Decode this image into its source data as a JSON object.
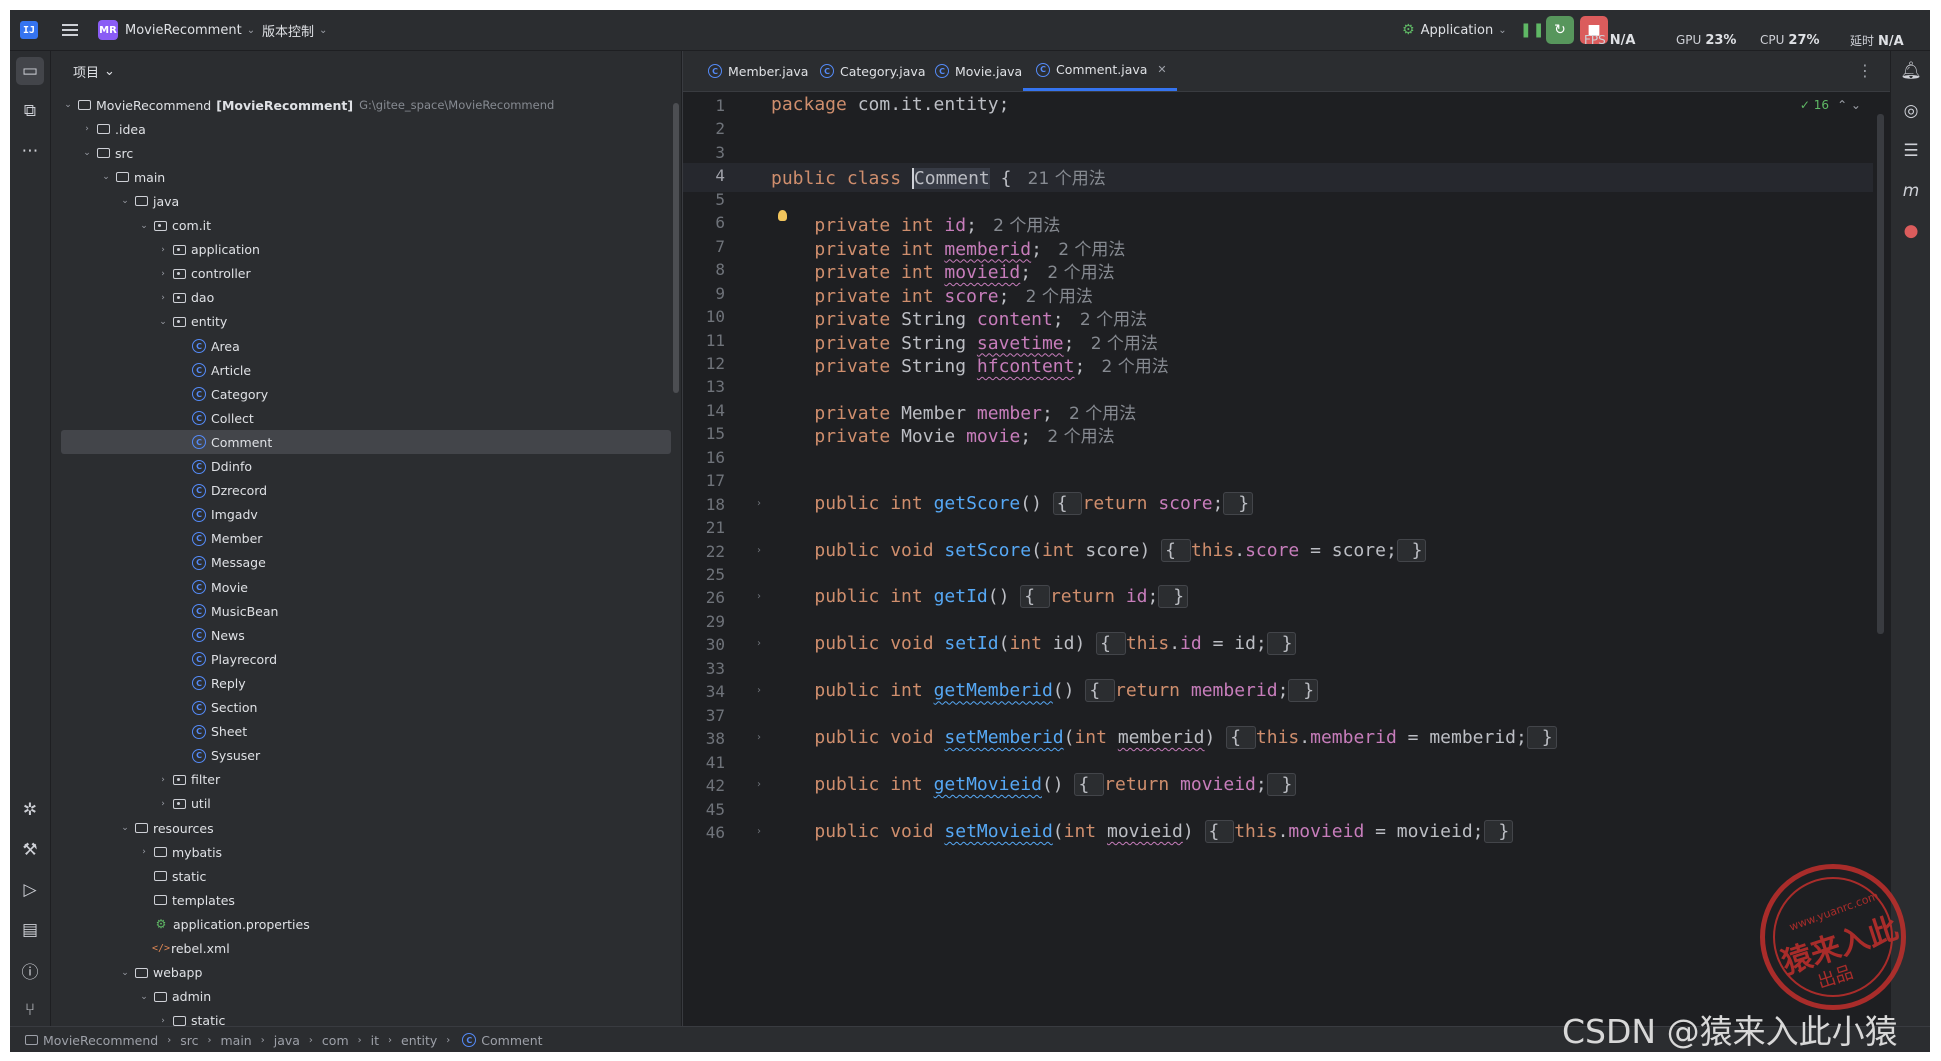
{
  "titlebar": {
    "app_logo": "IJ",
    "project_badge": "MR",
    "project_name": "MovieRecomment",
    "vcs_label": "版本控制",
    "run_config": "Application",
    "fps_label": "FPS",
    "fps_value": "N/A",
    "gpu_label": "GPU",
    "gpu_value": "23%",
    "cpu_label": "CPU",
    "cpu_value": "27%",
    "delay_label": "延时",
    "delay_value": "N/A"
  },
  "project_panel": {
    "title": "项目",
    "root_name": "MovieRecommend",
    "root_module": "[MovieRecomment]",
    "root_path": "G:\\gitee_space\\MovieRecommend",
    "tree": [
      {
        "label": ".idea",
        "depth": 1,
        "kind": "folder",
        "expanded": false
      },
      {
        "label": "src",
        "depth": 1,
        "kind": "folder",
        "expanded": true
      },
      {
        "label": "main",
        "depth": 2,
        "kind": "folder",
        "expanded": true
      },
      {
        "label": "java",
        "depth": 3,
        "kind": "folder",
        "expanded": true
      },
      {
        "label": "com.it",
        "depth": 4,
        "kind": "package",
        "expanded": true
      },
      {
        "label": "application",
        "depth": 5,
        "kind": "package",
        "expanded": false
      },
      {
        "label": "controller",
        "depth": 5,
        "kind": "package",
        "expanded": false
      },
      {
        "label": "dao",
        "depth": 5,
        "kind": "package",
        "expanded": false
      },
      {
        "label": "entity",
        "depth": 5,
        "kind": "package",
        "expanded": true
      },
      {
        "label": "Area",
        "depth": 6,
        "kind": "class"
      },
      {
        "label": "Article",
        "depth": 6,
        "kind": "class"
      },
      {
        "label": "Category",
        "depth": 6,
        "kind": "class"
      },
      {
        "label": "Collect",
        "depth": 6,
        "kind": "class"
      },
      {
        "label": "Comment",
        "depth": 6,
        "kind": "class",
        "selected": true
      },
      {
        "label": "Ddinfo",
        "depth": 6,
        "kind": "class"
      },
      {
        "label": "Dzrecord",
        "depth": 6,
        "kind": "class"
      },
      {
        "label": "Imgadv",
        "depth": 6,
        "kind": "class"
      },
      {
        "label": "Member",
        "depth": 6,
        "kind": "class"
      },
      {
        "label": "Message",
        "depth": 6,
        "kind": "class"
      },
      {
        "label": "Movie",
        "depth": 6,
        "kind": "class"
      },
      {
        "label": "MusicBean",
        "depth": 6,
        "kind": "class"
      },
      {
        "label": "News",
        "depth": 6,
        "kind": "class"
      },
      {
        "label": "Playrecord",
        "depth": 6,
        "kind": "class"
      },
      {
        "label": "Reply",
        "depth": 6,
        "kind": "class"
      },
      {
        "label": "Section",
        "depth": 6,
        "kind": "class"
      },
      {
        "label": "Sheet",
        "depth": 6,
        "kind": "class"
      },
      {
        "label": "Sysuser",
        "depth": 6,
        "kind": "class"
      },
      {
        "label": "filter",
        "depth": 5,
        "kind": "package",
        "expanded": false
      },
      {
        "label": "util",
        "depth": 5,
        "kind": "package",
        "expanded": false
      },
      {
        "label": "resources",
        "depth": 3,
        "kind": "folder",
        "expanded": true
      },
      {
        "label": "mybatis",
        "depth": 4,
        "kind": "folder",
        "expanded": false
      },
      {
        "label": "static",
        "depth": 4,
        "kind": "folder"
      },
      {
        "label": "templates",
        "depth": 4,
        "kind": "folder"
      },
      {
        "label": "application.properties",
        "depth": 4,
        "kind": "config"
      },
      {
        "label": "rebel.xml",
        "depth": 4,
        "kind": "xml"
      },
      {
        "label": "webapp",
        "depth": 3,
        "kind": "folder",
        "expanded": true
      },
      {
        "label": "admin",
        "depth": 4,
        "kind": "folder",
        "expanded": true
      },
      {
        "label": "static",
        "depth": 5,
        "kind": "folder",
        "expanded": false
      }
    ]
  },
  "editor": {
    "tabs": [
      {
        "label": "Member.java",
        "active": false
      },
      {
        "label": "Category.java",
        "active": false
      },
      {
        "label": "Movie.java",
        "active": false
      },
      {
        "label": "Comment.java",
        "active": true
      }
    ],
    "inspection_count": "16",
    "current_line": "4",
    "lines": [
      {
        "n": "1",
        "tokens": [
          [
            "kw",
            "package"
          ],
          [
            "p",
            " com.it.entity;"
          ]
        ]
      },
      {
        "n": "2",
        "tokens": []
      },
      {
        "n": "3",
        "tokens": []
      },
      {
        "n": "4",
        "tokens": [
          [
            "kw",
            "public class "
          ],
          [
            "cls",
            "Comment"
          ],
          [
            "p",
            " { "
          ],
          [
            "hint",
            " 21 个用法"
          ]
        ]
      },
      {
        "n": "5",
        "tokens": []
      },
      {
        "n": "6",
        "tokens": [
          [
            "p",
            "    "
          ],
          [
            "kw",
            "private int "
          ],
          [
            "fld",
            "id"
          ],
          [
            "p",
            "; "
          ],
          [
            "hint",
            " 2 个用法"
          ]
        ]
      },
      {
        "n": "7",
        "tokens": [
          [
            "p",
            "    "
          ],
          [
            "kw",
            "private int "
          ],
          [
            "fldu",
            "memberid"
          ],
          [
            "p",
            "; "
          ],
          [
            "hint",
            " 2 个用法"
          ]
        ]
      },
      {
        "n": "8",
        "tokens": [
          [
            "p",
            "    "
          ],
          [
            "kw",
            "private int "
          ],
          [
            "fldu",
            "movieid"
          ],
          [
            "p",
            "; "
          ],
          [
            "hint",
            " 2 个用法"
          ]
        ]
      },
      {
        "n": "9",
        "tokens": [
          [
            "p",
            "    "
          ],
          [
            "kw",
            "private int "
          ],
          [
            "fld",
            "score"
          ],
          [
            "p",
            "; "
          ],
          [
            "hint",
            " 2 个用法"
          ]
        ]
      },
      {
        "n": "10",
        "tokens": [
          [
            "p",
            "    "
          ],
          [
            "kw",
            "private "
          ],
          [
            "p",
            "String "
          ],
          [
            "fld",
            "content"
          ],
          [
            "p",
            "; "
          ],
          [
            "hint",
            " 2 个用法"
          ]
        ]
      },
      {
        "n": "11",
        "tokens": [
          [
            "p",
            "    "
          ],
          [
            "kw",
            "private "
          ],
          [
            "p",
            "String "
          ],
          [
            "fldu",
            "savetime"
          ],
          [
            "p",
            "; "
          ],
          [
            "hint",
            " 2 个用法"
          ]
        ]
      },
      {
        "n": "12",
        "tokens": [
          [
            "p",
            "    "
          ],
          [
            "kw",
            "private "
          ],
          [
            "p",
            "String "
          ],
          [
            "fldu",
            "hfcontent"
          ],
          [
            "p",
            "; "
          ],
          [
            "hint",
            " 2 个用法"
          ]
        ]
      },
      {
        "n": "13",
        "tokens": []
      },
      {
        "n": "14",
        "tokens": [
          [
            "p",
            "    "
          ],
          [
            "kw",
            "private "
          ],
          [
            "p",
            "Member "
          ],
          [
            "fld",
            "member"
          ],
          [
            "p",
            "; "
          ],
          [
            "hint",
            " 2 个用法"
          ]
        ]
      },
      {
        "n": "15",
        "tokens": [
          [
            "p",
            "    "
          ],
          [
            "kw",
            "private "
          ],
          [
            "p",
            "Movie "
          ],
          [
            "fld",
            "movie"
          ],
          [
            "p",
            "; "
          ],
          [
            "hint",
            " 2 个用法"
          ]
        ]
      },
      {
        "n": "16",
        "tokens": []
      },
      {
        "n": "17",
        "tokens": []
      },
      {
        "n": "18",
        "fold": true,
        "tokens": [
          [
            "p",
            "    "
          ],
          [
            "kw",
            "public int "
          ],
          [
            "fn",
            "getScore"
          ],
          [
            "p",
            "() "
          ],
          [
            "box",
            "{ "
          ],
          [
            "kw",
            "return "
          ],
          [
            "fld",
            "score"
          ],
          [
            "p",
            ";"
          ],
          [
            "box",
            " }"
          ]
        ]
      },
      {
        "n": "21",
        "tokens": []
      },
      {
        "n": "22",
        "fold": true,
        "tokens": [
          [
            "p",
            "    "
          ],
          [
            "kw",
            "public void "
          ],
          [
            "fn",
            "setScore"
          ],
          [
            "p",
            "("
          ],
          [
            "kw",
            "int "
          ],
          [
            "p",
            "score) "
          ],
          [
            "box",
            "{ "
          ],
          [
            "kw",
            "this"
          ],
          [
            "p",
            "."
          ],
          [
            "fld",
            "score"
          ],
          [
            "p",
            " = score;"
          ],
          [
            "box",
            " }"
          ]
        ]
      },
      {
        "n": "25",
        "tokens": []
      },
      {
        "n": "26",
        "fold": true,
        "tokens": [
          [
            "p",
            "    "
          ],
          [
            "kw",
            "public int "
          ],
          [
            "fn",
            "getId"
          ],
          [
            "p",
            "() "
          ],
          [
            "box",
            "{ "
          ],
          [
            "kw",
            "return "
          ],
          [
            "fld",
            "id"
          ],
          [
            "p",
            ";"
          ],
          [
            "box",
            " }"
          ]
        ]
      },
      {
        "n": "29",
        "tokens": []
      },
      {
        "n": "30",
        "fold": true,
        "tokens": [
          [
            "p",
            "    "
          ],
          [
            "kw",
            "public void "
          ],
          [
            "fn",
            "setId"
          ],
          [
            "p",
            "("
          ],
          [
            "kw",
            "int "
          ],
          [
            "p",
            "id) "
          ],
          [
            "box",
            "{ "
          ],
          [
            "kw",
            "this"
          ],
          [
            "p",
            "."
          ],
          [
            "fld",
            "id"
          ],
          [
            "p",
            " = id;"
          ],
          [
            "box",
            " }"
          ]
        ]
      },
      {
        "n": "33",
        "tokens": []
      },
      {
        "n": "34",
        "fold": true,
        "tokens": [
          [
            "p",
            "    "
          ],
          [
            "kw",
            "public int "
          ],
          [
            "fnu",
            "getMemberid"
          ],
          [
            "p",
            "() "
          ],
          [
            "box",
            "{ "
          ],
          [
            "kw",
            "return "
          ],
          [
            "fld",
            "memberid"
          ],
          [
            "p",
            ";"
          ],
          [
            "box",
            " }"
          ]
        ]
      },
      {
        "n": "37",
        "tokens": []
      },
      {
        "n": "38",
        "fold": true,
        "tokens": [
          [
            "p",
            "    "
          ],
          [
            "kw",
            "public void "
          ],
          [
            "fnu",
            "setMemberid"
          ],
          [
            "p",
            "("
          ],
          [
            "kw",
            "int "
          ],
          [
            "pu",
            "memberid"
          ],
          [
            "p",
            ") "
          ],
          [
            "box",
            "{ "
          ],
          [
            "kw",
            "this"
          ],
          [
            "p",
            "."
          ],
          [
            "fld",
            "memberid"
          ],
          [
            "p",
            " = memberid;"
          ],
          [
            "box",
            " }"
          ]
        ]
      },
      {
        "n": "41",
        "tokens": []
      },
      {
        "n": "42",
        "fold": true,
        "tokens": [
          [
            "p",
            "    "
          ],
          [
            "kw",
            "public int "
          ],
          [
            "fnu",
            "getMovieid"
          ],
          [
            "p",
            "() "
          ],
          [
            "box",
            "{ "
          ],
          [
            "kw",
            "return "
          ],
          [
            "fld",
            "movieid"
          ],
          [
            "p",
            ";"
          ],
          [
            "box",
            " }"
          ]
        ]
      },
      {
        "n": "45",
        "tokens": []
      },
      {
        "n": "46",
        "fold": true,
        "tokens": [
          [
            "p",
            "    "
          ],
          [
            "kw",
            "public void "
          ],
          [
            "fnu",
            "setMovieid"
          ],
          [
            "p",
            "("
          ],
          [
            "kw",
            "int "
          ],
          [
            "pu",
            "movieid"
          ],
          [
            "p",
            ") "
          ],
          [
            "box",
            "{ "
          ],
          [
            "kw",
            "this"
          ],
          [
            "p",
            "."
          ],
          [
            "fld",
            "movieid"
          ],
          [
            "p",
            " = movieid;"
          ],
          [
            "box",
            " }"
          ]
        ]
      }
    ]
  },
  "statusbar": {
    "breadcrumb": [
      "MovieRecommend",
      "src",
      "main",
      "java",
      "com",
      "it",
      "entity",
      "Comment"
    ]
  },
  "watermark": {
    "text": "CSDN @猿来入此小猿",
    "stamp_text": "猿来入此",
    "stamp_sub": "出品",
    "stamp_url": "www.yuanrc.com"
  },
  "colors": {
    "accent": "#3574f0",
    "keyword": "#cf8e6d",
    "field": "#c77dbb",
    "method": "#56a8f5",
    "stamp": "#c8302c"
  }
}
